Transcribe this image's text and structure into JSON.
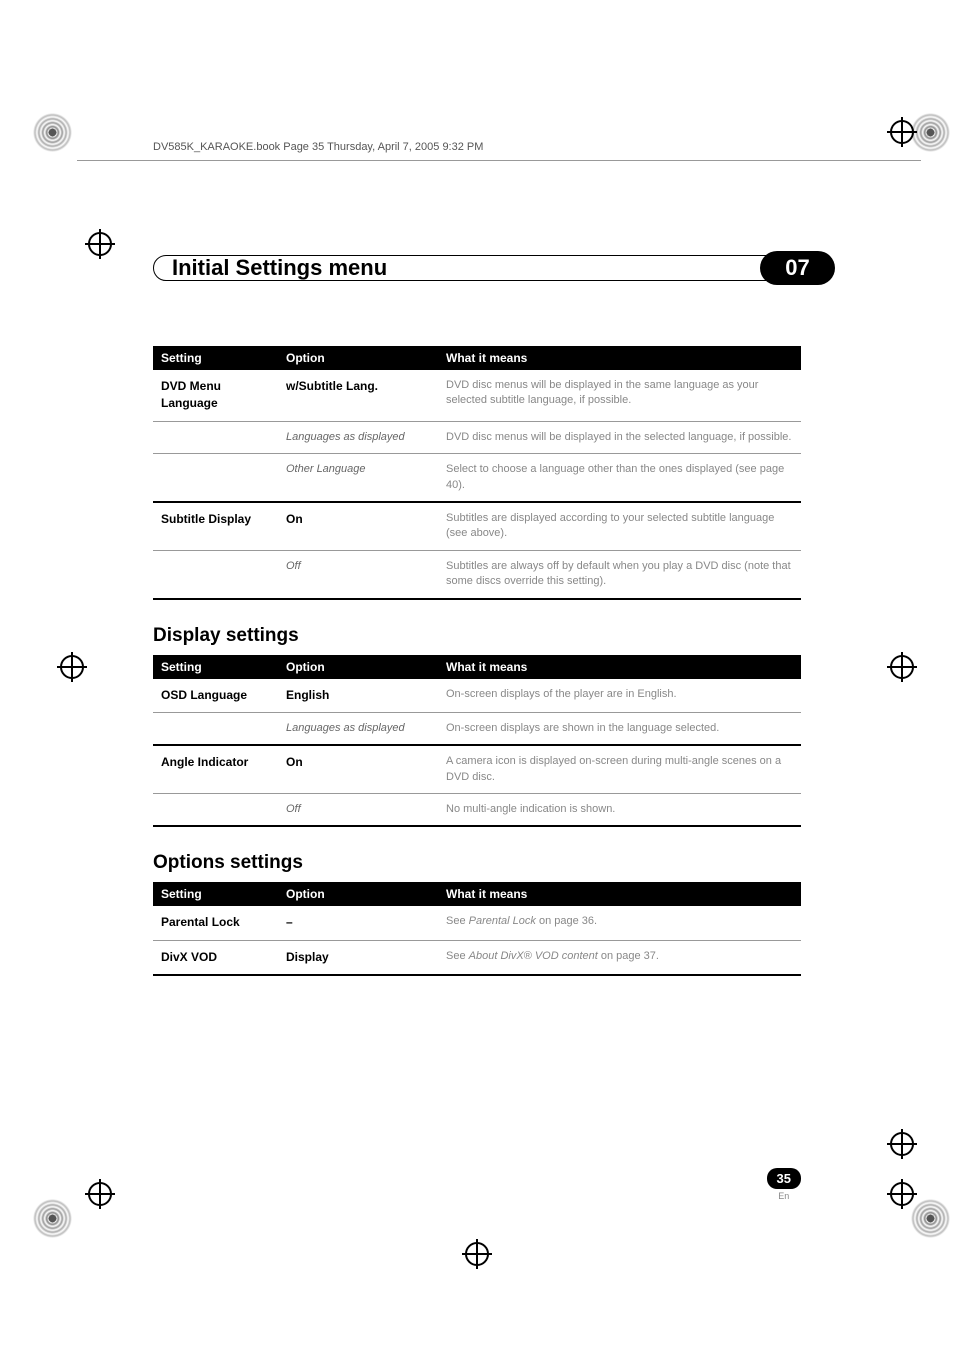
{
  "book_header": "DV585K_KARAOKE.book  Page 35  Thursday, April 7, 2005  9:32 PM",
  "chapter": {
    "title": "Initial Settings menu",
    "number": "07"
  },
  "table1": {
    "headers": [
      "Setting",
      "Option",
      "What it means"
    ],
    "rows": [
      {
        "setting": "DVD Menu Language",
        "option": "w/Subtitle Lang.",
        "option_style": "bold",
        "desc": "DVD disc menus will be displayed in the same language as your selected subtitle language, if possible."
      },
      {
        "setting": "",
        "option": "Languages as displayed",
        "option_style": "italic",
        "desc": "DVD disc menus will be displayed in the selected language, if possible."
      },
      {
        "setting": "",
        "option": "Other Language",
        "option_style": "italic",
        "desc": "Select to choose a language other than the ones displayed (see page 40).",
        "thick": true
      },
      {
        "setting": "Subtitle Display",
        "option": "On",
        "option_style": "bold",
        "desc": "Subtitles are displayed according to your selected subtitle language (see above)."
      },
      {
        "setting": "",
        "option": "Off",
        "option_style": "italic",
        "desc": "Subtitles are always off by default when you play a DVD disc (note that some discs override this setting)."
      }
    ]
  },
  "section2_heading": "Display settings",
  "table2": {
    "headers": [
      "Setting",
      "Option",
      "What it means"
    ],
    "rows": [
      {
        "setting": "OSD Language",
        "option": "English",
        "option_style": "bold",
        "desc": "On-screen displays of the player are in English."
      },
      {
        "setting": "",
        "option": "Languages as displayed",
        "option_style": "italic",
        "desc": "On-screen displays are shown in the language selected.",
        "thick": true
      },
      {
        "setting": "Angle Indicator",
        "option": "On",
        "option_style": "bold",
        "desc": "A camera icon is displayed on-screen during multi-angle scenes on a DVD disc."
      },
      {
        "setting": "",
        "option": "Off",
        "option_style": "italic",
        "desc": "No multi-angle indication is shown."
      }
    ]
  },
  "section3_heading": "Options settings",
  "table3": {
    "headers": [
      "Setting",
      "Option",
      "What it means"
    ],
    "rows": [
      {
        "setting": "Parental Lock",
        "option": "–",
        "option_style": "bold",
        "desc_pre": "See ",
        "desc_italic": "Parental Lock",
        "desc_post": " on page 36."
      },
      {
        "setting": "DivX VOD",
        "option": "Display",
        "option_style": "bold",
        "desc_pre": "See ",
        "desc_italic": "About DivX® VOD content",
        "desc_post": " on page 37."
      }
    ]
  },
  "page": {
    "number": "35",
    "lang": "En"
  }
}
